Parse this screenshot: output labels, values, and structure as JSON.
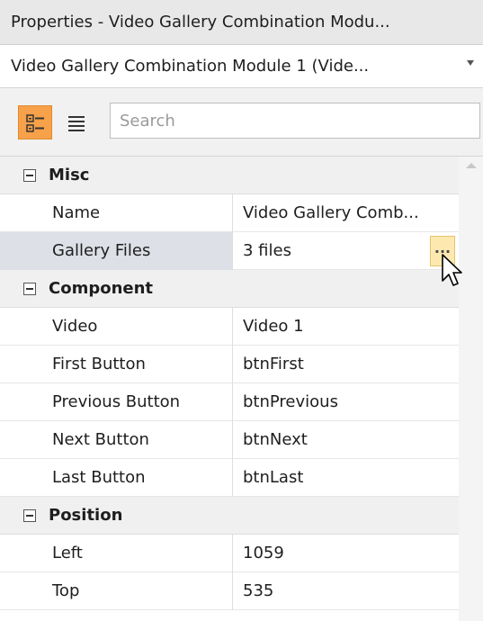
{
  "window": {
    "title": "Properties - Video Gallery Combination Modu..."
  },
  "selector": {
    "value": "Video Gallery Combination Module 1 (Vide..."
  },
  "toolbar": {
    "search_placeholder": "Search"
  },
  "grid": {
    "categories": [
      {
        "label": "Misc",
        "properties": [
          {
            "name": "Name",
            "value": "Video Gallery Comb..."
          },
          {
            "name": "Gallery Files",
            "value": "3 files",
            "ellipsis": "..."
          }
        ]
      },
      {
        "label": "Component",
        "properties": [
          {
            "name": "Video",
            "value": "Video 1"
          },
          {
            "name": "First Button",
            "value": "btnFirst"
          },
          {
            "name": "Previous Button",
            "value": "btnPrevious"
          },
          {
            "name": "Next Button",
            "value": "btnNext"
          },
          {
            "name": "Last Button",
            "value": "btnLast"
          }
        ]
      },
      {
        "label": "Position",
        "properties": [
          {
            "name": "Left",
            "value": "1059"
          },
          {
            "name": "Top",
            "value": "535"
          }
        ]
      }
    ]
  },
  "colors": {
    "accent": "#f7a14a",
    "selected_row": "#dde0e6",
    "ellipsis_button": "#fde9b0"
  },
  "icons": {
    "categorized": "categorized-view-icon",
    "alphabetical": "alphabetical-view-icon",
    "collapse": "collapse-icon",
    "cursor": "mouse-cursor-icon"
  }
}
